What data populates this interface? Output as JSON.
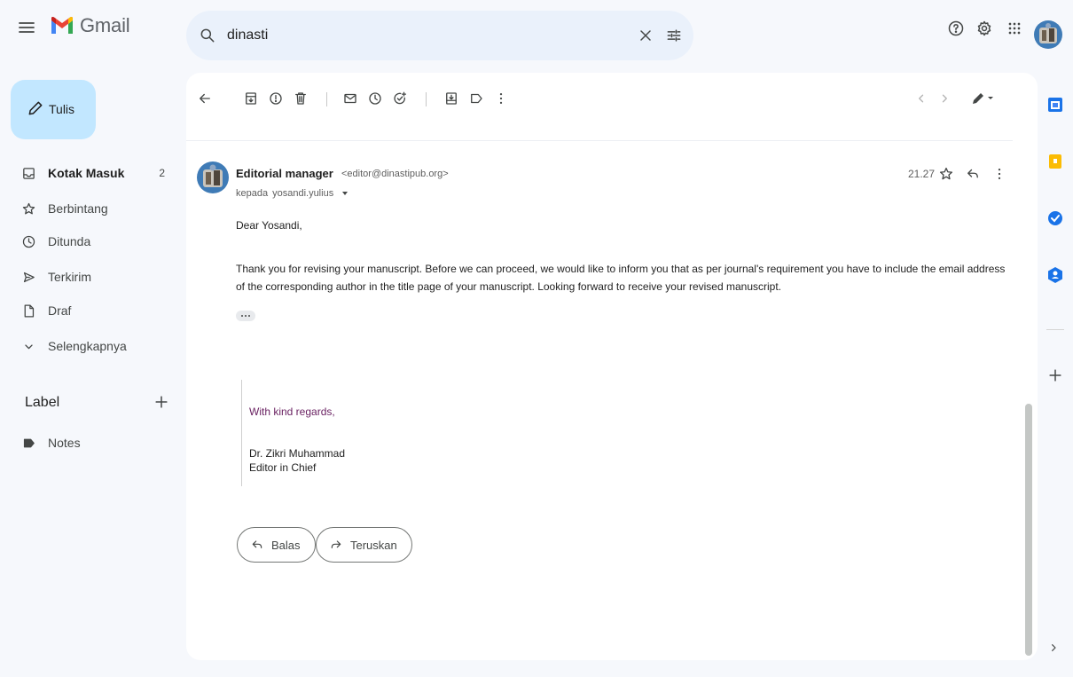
{
  "app": {
    "name": "Gmail"
  },
  "search": {
    "value": "dinasti"
  },
  "compose": {
    "label": "Tulis"
  },
  "sidebar": {
    "items": [
      {
        "label": "Kotak Masuk",
        "count": "2",
        "icon": "inbox-icon"
      },
      {
        "label": "Berbintang",
        "icon": "star-icon"
      },
      {
        "label": "Ditunda",
        "icon": "clock-icon"
      },
      {
        "label": "Terkirim",
        "icon": "send-icon"
      },
      {
        "label": "Draf",
        "icon": "draft-icon"
      },
      {
        "label": "Selengkapnya",
        "icon": "chevron-down-icon"
      }
    ],
    "labels_heading": "Label",
    "labels": [
      {
        "label": "Notes",
        "icon": "label-icon"
      }
    ]
  },
  "message": {
    "sender_name": "Editorial manager",
    "sender_email": "<editor@dinastipub.org>",
    "to_prefix": "kepada",
    "to_name": "yosandi.yulius",
    "time": "21.27",
    "greeting": "Dear Yosandi,",
    "body": "Thank you for revising your manuscript.    Before we can proceed, we would like to inform you that as per journal's requirement you have to include the email address of the corresponding author in the title page of your manuscript.    Looking forward to receive your revised manuscript.",
    "signature": {
      "regards": "With kind regards,",
      "name": "Dr. Zikri Muhammad",
      "title": "Editor in Chief"
    }
  },
  "actions": {
    "reply": "Balas",
    "forward": "Teruskan"
  },
  "colors": {
    "compose_bg": "#c2e7ff",
    "search_bg": "#eaf1fb",
    "signature_accent": "#681f60",
    "page_bg": "#f6f8fc"
  }
}
